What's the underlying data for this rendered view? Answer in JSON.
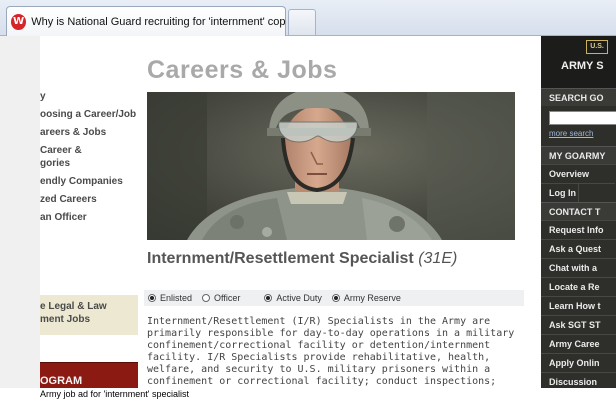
{
  "browser": {
    "tab_title": "Why is National Guard recruiting for 'internment' cops?",
    "tab_icon": "wordpress-icon",
    "favicon_letter": "W"
  },
  "page": {
    "heading": "Careers & Jobs",
    "left_nav": [
      "y",
      "oosing a Career/Job",
      "areers & Jobs",
      "Career &",
      "gories",
      "endly Companies",
      "zed Careers",
      "an Officer"
    ],
    "legal_box": [
      "e Legal & Law",
      "ment Jobs"
    ],
    "program_bar": "OGRAM",
    "job_title": "Internment/Resettlement Specialist",
    "job_code": "(31E)",
    "options": {
      "enlisted": "Enlisted",
      "officer": "Officer",
      "active_duty": "Active Duty",
      "army_reserve": "Army Reserve"
    },
    "body_text": "Internment/Resettlement (I/R) Specialists in the Army are primarily responsible for day-to-day operations in a military confinement/correctional facility or detention/internment facility. I/R Specialists provide rehabilitative, health, welfare, and security to U.S. military prisoners within a confinement or correctional facility; conduct inspections; prepare written reports; and coordinate activities of"
  },
  "right_nav": {
    "badge": "U.S.",
    "army_label": "ARMY S",
    "search_label": "SEARCH GO",
    "more_search": "more search",
    "my_section": "MY GOARMY",
    "my_items": [
      "Overview"
    ],
    "login_items": [
      "Log In",
      ""
    ],
    "contact_section": "CONTACT T",
    "contact_items": [
      "Request Info",
      "Ask a Quest",
      "Chat with a",
      "Locate a Re",
      "Learn How t",
      "Ask SGT ST",
      "Army Caree",
      "Apply Onlin",
      "Discussion"
    ]
  },
  "caption": "Army job ad for 'internment' specialist"
}
